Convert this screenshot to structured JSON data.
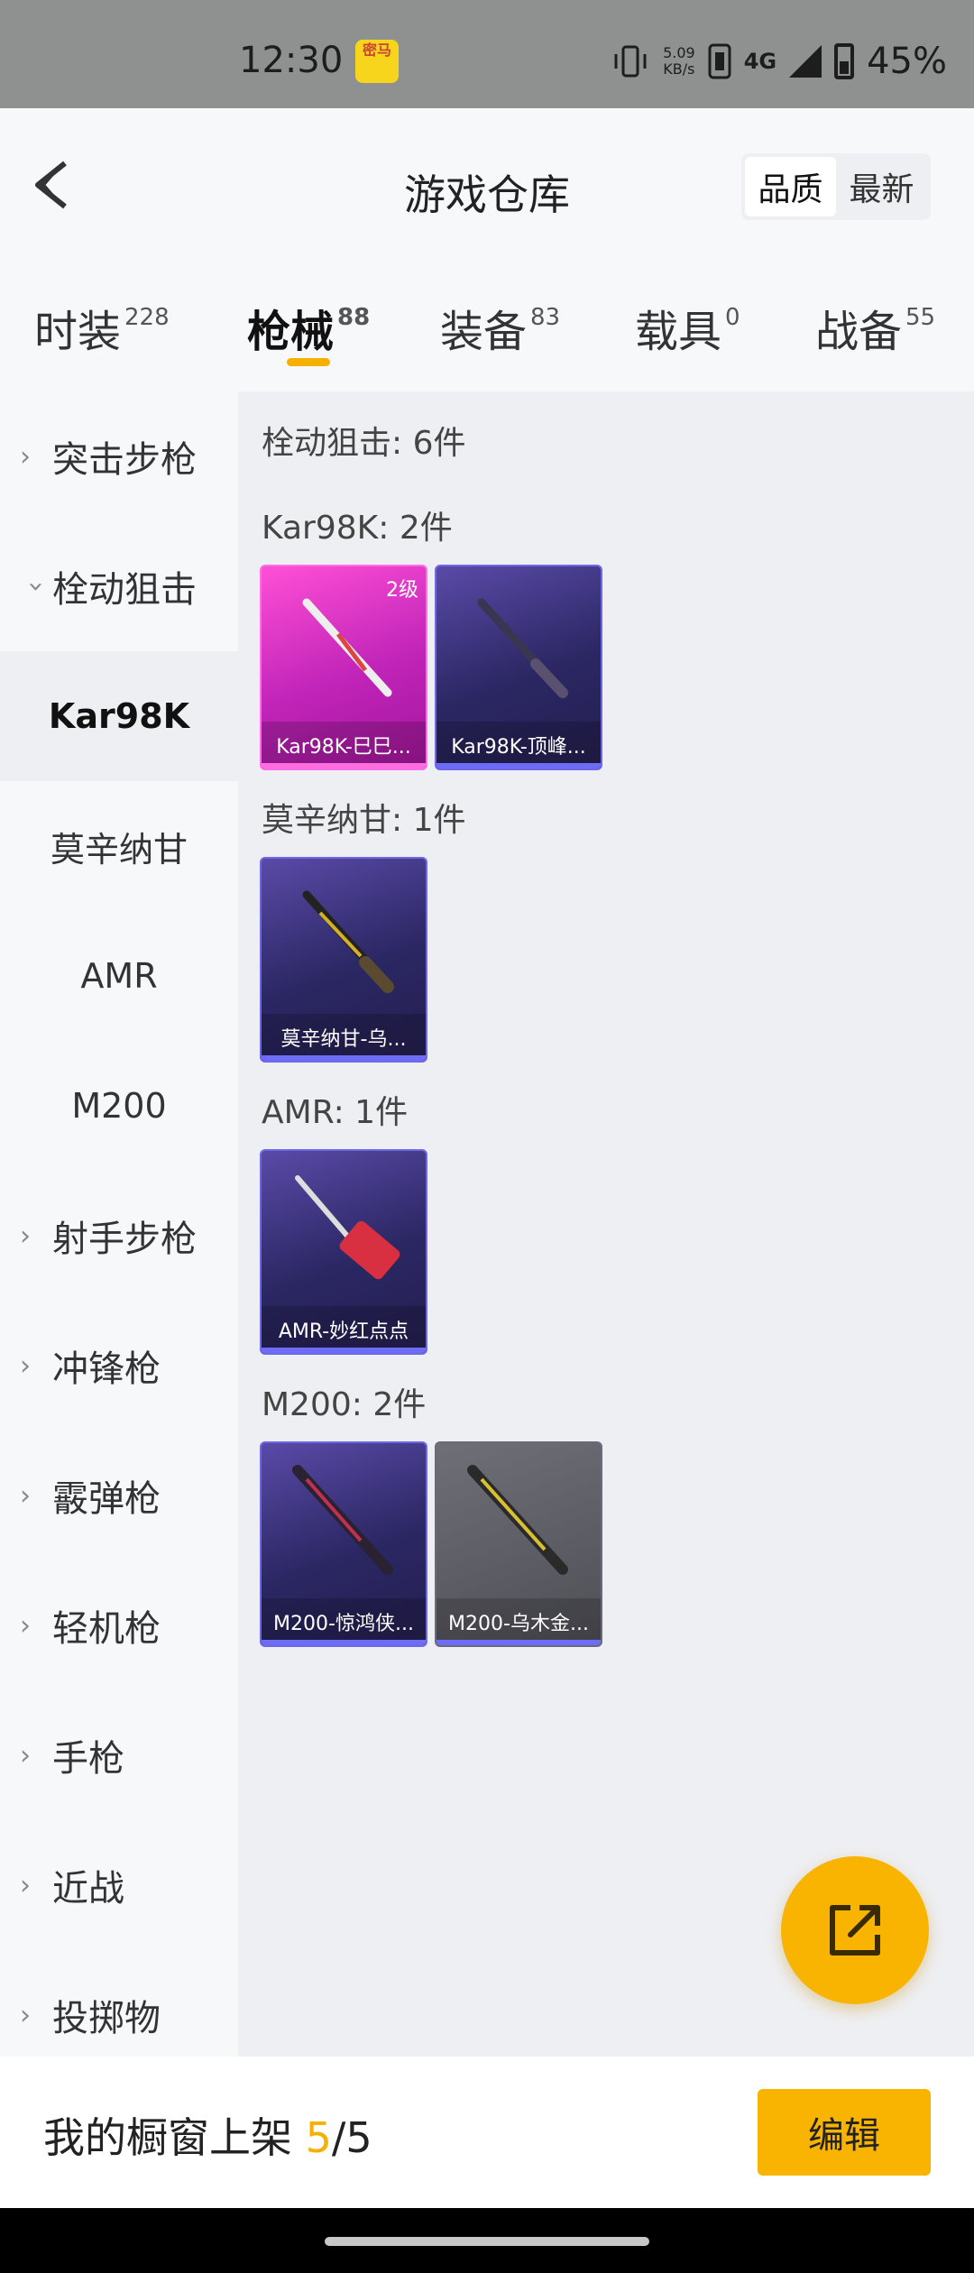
{
  "status_bar": {
    "time": "12:30",
    "app_badge": "密马",
    "net_speed_value": "5.09",
    "net_speed_unit": "KB/s",
    "network": "4G",
    "battery": "45%"
  },
  "header": {
    "title": "游戏仓库",
    "sort_options": [
      "品质",
      "最新"
    ],
    "sort_selected": "品质"
  },
  "tabs": [
    {
      "label": "时装",
      "count": "228"
    },
    {
      "label": "枪械",
      "count": "88"
    },
    {
      "label": "装备",
      "count": "83"
    },
    {
      "label": "载具",
      "count": "0"
    },
    {
      "label": "战备",
      "count": "55"
    }
  ],
  "active_tab": "枪械",
  "sidebar": {
    "items": [
      {
        "label": "突击步枪",
        "type": "category",
        "expanded": false
      },
      {
        "label": "栓动狙击",
        "type": "category",
        "expanded": true
      },
      {
        "label": "Kar98K",
        "type": "sub",
        "active": true
      },
      {
        "label": "莫辛纳甘",
        "type": "sub"
      },
      {
        "label": "AMR",
        "type": "sub"
      },
      {
        "label": "M200",
        "type": "sub"
      },
      {
        "label": "射手步枪",
        "type": "category",
        "expanded": false
      },
      {
        "label": "冲锋枪",
        "type": "category",
        "expanded": false
      },
      {
        "label": "霰弹枪",
        "type": "category",
        "expanded": false
      },
      {
        "label": "轻机枪",
        "type": "category",
        "expanded": false
      },
      {
        "label": "手枪",
        "type": "category",
        "expanded": false
      },
      {
        "label": "近战",
        "type": "category",
        "expanded": false
      },
      {
        "label": "投掷物",
        "type": "category",
        "expanded": false
      }
    ]
  },
  "content": {
    "summary": "栓动狙击: 6件",
    "groups": [
      {
        "label": "Kar98K: 2件",
        "items": [
          {
            "name": "Kar98K-巳巳...",
            "level": "2级",
            "rarity": "pink",
            "gun_color": "#e8e8f0"
          },
          {
            "name": "Kar98K-顶峰...",
            "rarity": "purple",
            "gun_color": "#3a3550"
          }
        ]
      },
      {
        "label": "莫辛纳甘: 1件",
        "items": [
          {
            "name": "莫辛纳甘-乌...",
            "rarity": "purple",
            "gun_color": "#d4b024"
          }
        ]
      },
      {
        "label": "AMR: 1件",
        "items": [
          {
            "name": "AMR-妙红点点",
            "rarity": "purple",
            "gun_color": "#d83040"
          }
        ]
      },
      {
        "label": "M200: 2件",
        "items": [
          {
            "name": "M200-惊鸿侠...",
            "rarity": "purple",
            "gun_color": "#c03050"
          },
          {
            "name": "M200-乌木金...",
            "rarity": "gray",
            "gun_color": "#d8c030"
          }
        ]
      }
    ]
  },
  "fab_icon": "share-external-icon",
  "bottom": {
    "showcase_label": "我的橱窗上架",
    "showcase_current": "5",
    "showcase_sep": "/",
    "showcase_total": "5",
    "edit_label": "编辑"
  },
  "colors": {
    "accent": "#f8b400",
    "pink_rarity": "#c024b8",
    "purple_rarity": "#2b2763"
  }
}
